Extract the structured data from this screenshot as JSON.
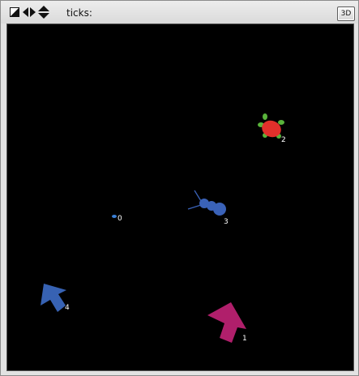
{
  "toolbar": {
    "ticks_label": "ticks:",
    "three_d_button": "3D"
  },
  "world": {
    "background": "#000000",
    "agents": [
      {
        "id_label": "0",
        "shape": "small-dot",
        "color": "#3a7fd5"
      },
      {
        "id_label": "1",
        "shape": "arrow",
        "color": "#b01f6b"
      },
      {
        "id_label": "2",
        "shape": "turtle",
        "color": "#e1302b",
        "accent": "#59b33b"
      },
      {
        "id_label": "3",
        "shape": "ant",
        "color": "#3a62b8"
      },
      {
        "id_label": "4",
        "shape": "arrow",
        "color": "#3762b3"
      }
    ]
  }
}
